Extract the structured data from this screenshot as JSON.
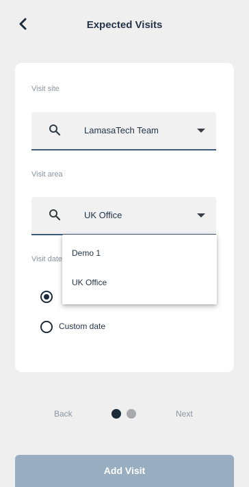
{
  "header": {
    "title": "Expected Visits",
    "back_icon": "chevron-left-icon"
  },
  "form": {
    "visit_site": {
      "label": "Visit site",
      "value": "LamasaTech Team",
      "icon": "search-icon"
    },
    "visit_area": {
      "label": "Visit area",
      "value": "UK Office",
      "icon": "search-icon"
    },
    "visit_date": {
      "label": "Visit date",
      "options": [
        {
          "label": "",
          "checked": true
        },
        {
          "label": "Custom date",
          "checked": false
        }
      ]
    }
  },
  "dropdown": {
    "options": [
      "Demo 1",
      "UK Office"
    ]
  },
  "pager": {
    "back_label": "Back",
    "next_label": "Next",
    "current_page": 1,
    "total_pages": 2
  },
  "footer": {
    "add_label": "Add Visit"
  },
  "colors": {
    "accent": "#1c2b3a",
    "inactive_dot": "#a7a9ac",
    "button": "#98aec0",
    "underline": "#3b5a7a"
  }
}
